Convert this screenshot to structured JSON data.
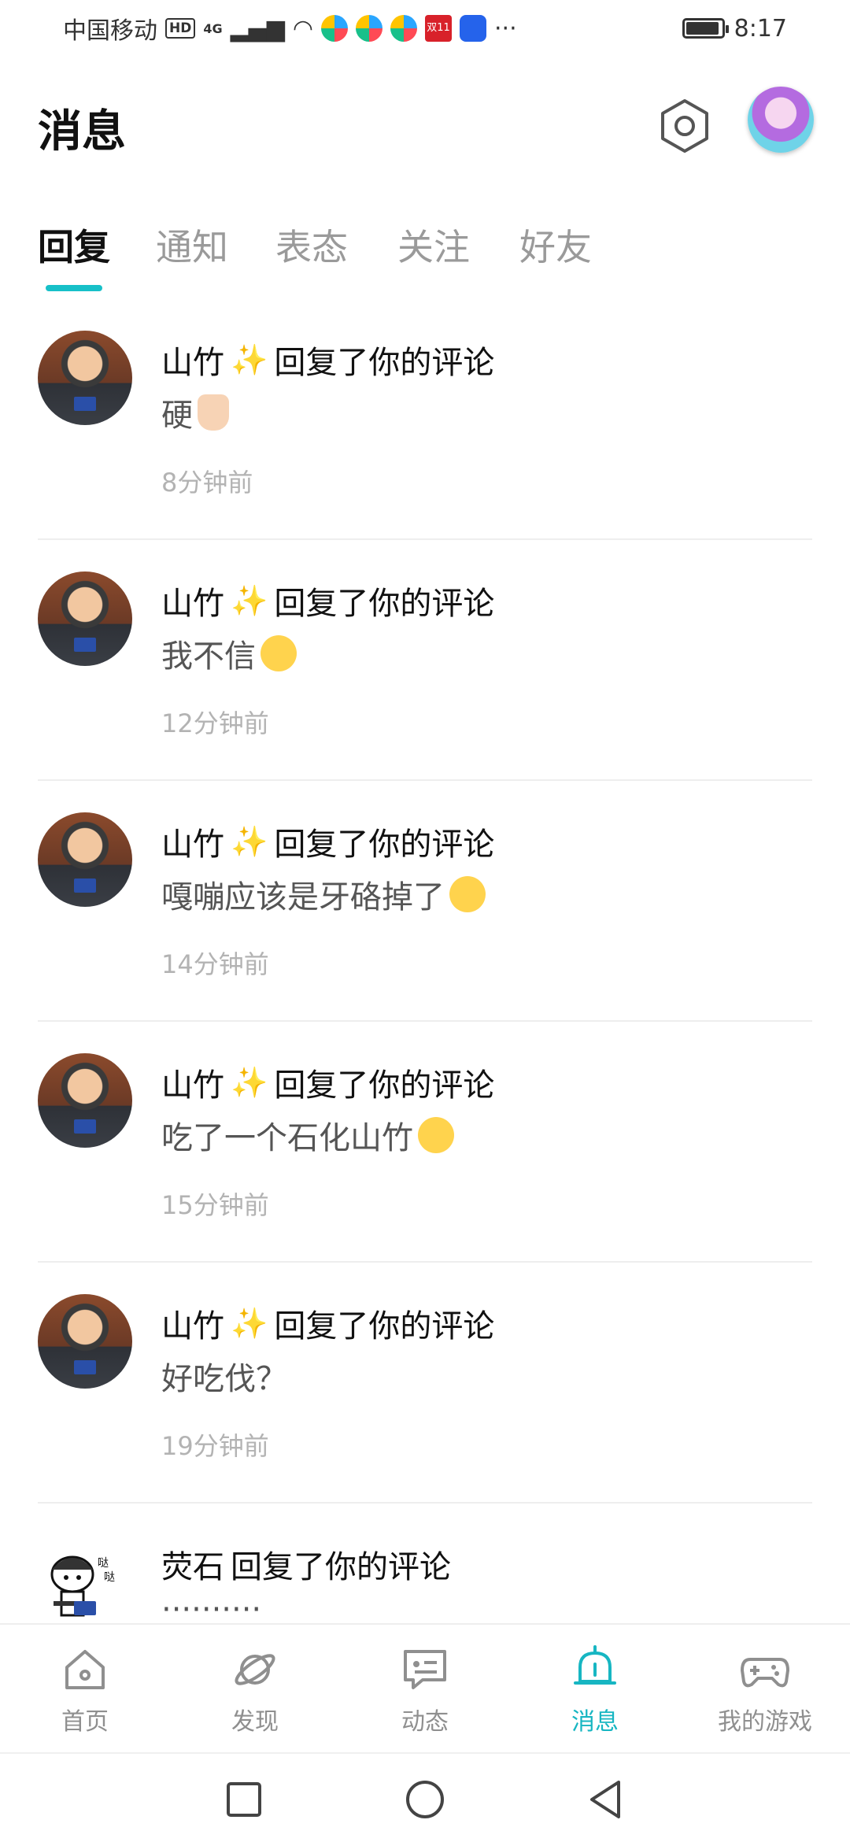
{
  "status_bar": {
    "carrier": "中国移动",
    "hd": "HD",
    "signal": "4G",
    "shopping_badge": "双11",
    "more": "···",
    "time": "8:17",
    "battery_level": 0.95
  },
  "header": {
    "title": "消息",
    "settings_icon": "settings-hexagon-icon",
    "avatar_icon": "profile-avatar"
  },
  "tabs": [
    {
      "label": "回复",
      "active": true
    },
    {
      "label": "通知",
      "active": false
    },
    {
      "label": "表态",
      "active": false
    },
    {
      "label": "关注",
      "active": false
    },
    {
      "label": "好友",
      "active": false
    }
  ],
  "messages": [
    {
      "user": "山竹",
      "badge": "✨",
      "action": "回复了你的评论",
      "body": "硬",
      "emoji": "thumbs-up",
      "time": "8分钟前"
    },
    {
      "user": "山竹",
      "badge": "✨",
      "action": "回复了你的评论",
      "body": "我不信",
      "emoji": "nerd-face",
      "time": "12分钟前"
    },
    {
      "user": "山竹",
      "badge": "✨",
      "action": "回复了你的评论",
      "body": "嘎嘣应该是牙硌掉了",
      "emoji": "kissing-face",
      "time": "14分钟前"
    },
    {
      "user": "山竹",
      "badge": "✨",
      "action": "回复了你的评论",
      "body": "吃了一个石化山竹",
      "emoji": "hushed-face",
      "time": "15分钟前"
    },
    {
      "user": "山竹",
      "badge": "✨",
      "action": "回复了你的评论",
      "body": "好吃伐？",
      "emoji": "",
      "time": "19分钟前"
    },
    {
      "user": "荧石",
      "badge": "",
      "action": "回复了你的评论",
      "body": "··········",
      "emoji": "",
      "time": ""
    }
  ],
  "bottom_nav": [
    {
      "label": "首页",
      "icon": "home-icon",
      "active": false
    },
    {
      "label": "发现",
      "icon": "planet-icon",
      "active": false
    },
    {
      "label": "动态",
      "icon": "chat-bubble-icon",
      "active": false
    },
    {
      "label": "消息",
      "icon": "bell-icon",
      "active": true
    },
    {
      "label": "我的游戏",
      "icon": "gamepad-icon",
      "active": false
    }
  ],
  "colors": {
    "accent": "#17b6c2",
    "tab_indicator": "#17c0c8",
    "time_text": "#b3b3b3"
  }
}
